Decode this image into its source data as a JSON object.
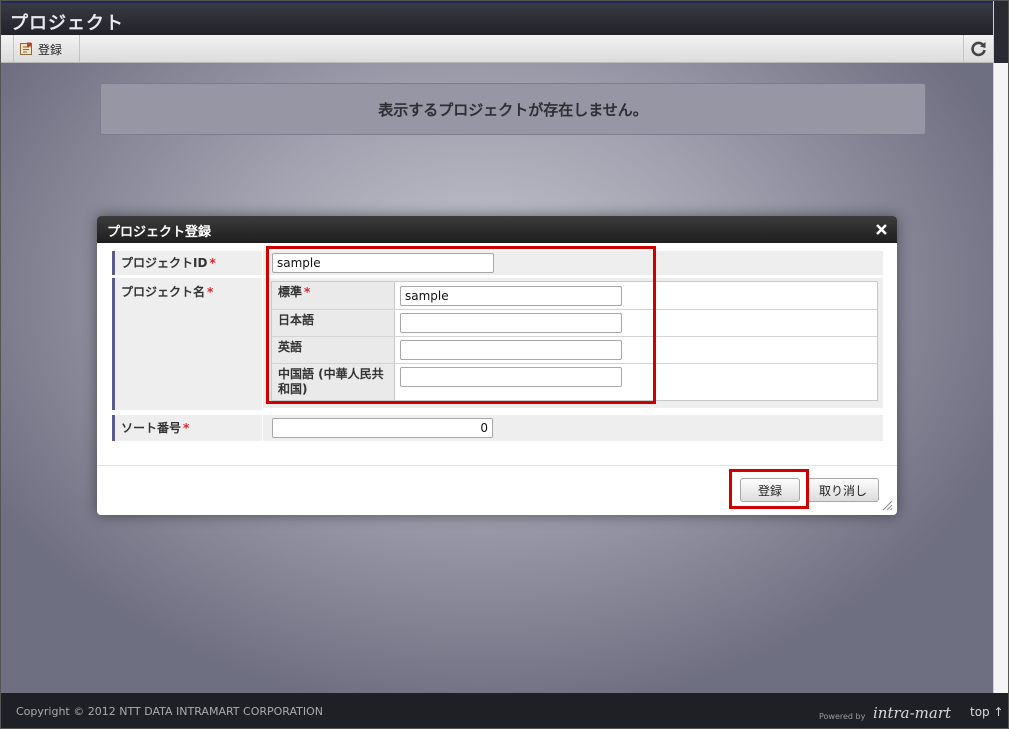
{
  "page": {
    "title": "プロジェクト"
  },
  "toolbar": {
    "register_label": "登録"
  },
  "notice": {
    "text": "表示するプロジェクトが存在しません。"
  },
  "dialog": {
    "title": "プロジェクト登録",
    "fields": {
      "project_id": {
        "label": "プロジェクトID",
        "required_mark": "*",
        "value": "sample"
      },
      "project_name": {
        "label": "プロジェクト名",
        "required_mark": "*",
        "locales": [
          {
            "label": "標準",
            "required_mark": "*",
            "value": "sample"
          },
          {
            "label": "日本語",
            "value": ""
          },
          {
            "label": "英語",
            "value": ""
          },
          {
            "label": "中国語 (中華人民共和国)",
            "value": ""
          }
        ]
      },
      "sort_number": {
        "label": "ソート番号",
        "required_mark": "*",
        "value": "0"
      }
    },
    "buttons": {
      "register": "登録",
      "cancel": "取り消し"
    }
  },
  "footer": {
    "copyright": "Copyright © 2012 NTT DATA INTRAMART CORPORATION",
    "powered_by": "Powered by",
    "logo_text": "intra-mart",
    "top_link": "top"
  },
  "colors": {
    "highlight": "#d10000",
    "required": "#dd2222",
    "header_dark": "#22222a"
  }
}
